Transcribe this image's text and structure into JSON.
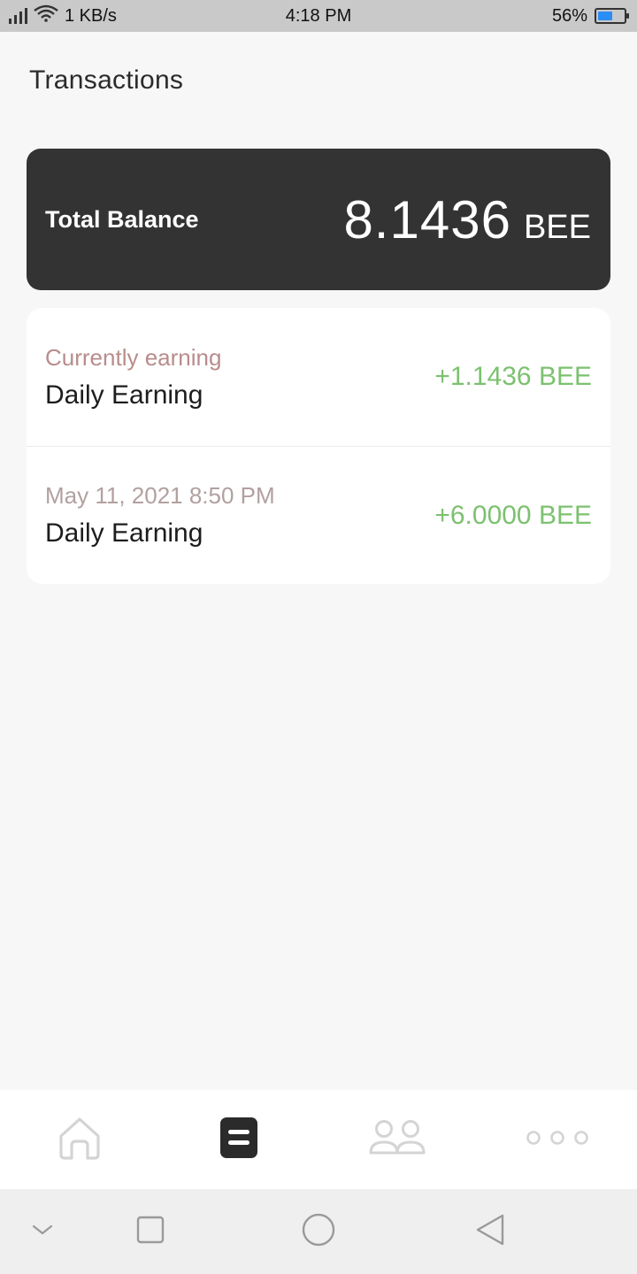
{
  "status_bar": {
    "speed": "1 KB/s",
    "time": "4:18 PM",
    "battery_percent": "56%",
    "battery_level": 0.56,
    "accent": "#2c8df5"
  },
  "page": {
    "title": "Transactions"
  },
  "balance": {
    "label": "Total Balance",
    "amount": "8.1436",
    "unit": "BEE"
  },
  "transactions": [
    {
      "subtitle": "Currently earning",
      "title": "Daily Earning",
      "amount": "+1.1436 BEE"
    },
    {
      "subtitle": "May 11, 2021 8:50 PM",
      "title": "Daily Earning",
      "amount": "+6.0000 BEE"
    }
  ],
  "bottom_nav": {
    "items": [
      {
        "icon": "home-icon",
        "active": false
      },
      {
        "icon": "transactions-icon",
        "active": true
      },
      {
        "icon": "users-icon",
        "active": false
      },
      {
        "icon": "more-icon",
        "active": false
      }
    ]
  },
  "system_nav": {
    "icons": [
      "chevron-down-icon",
      "recents-icon",
      "home-circle-icon",
      "back-icon"
    ]
  },
  "colors": {
    "background": "#f7f7f7",
    "card_dark": "#333333",
    "positive": "#7cc16f",
    "subtitle": "#b98c8c"
  }
}
